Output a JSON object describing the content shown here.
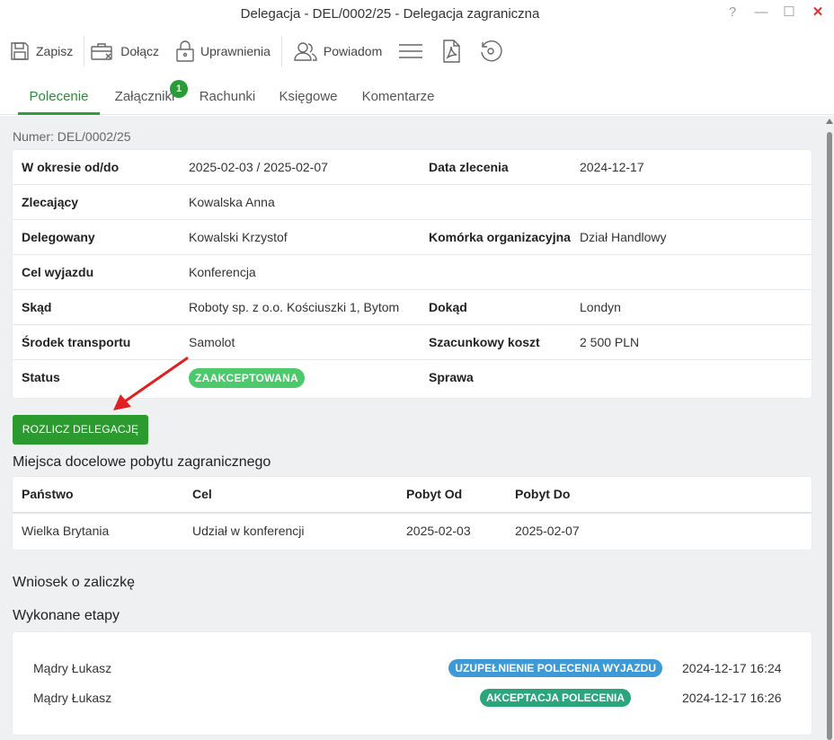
{
  "window": {
    "title": "Delegacja - DEL/0002/25 - Delegacja zagraniczna",
    "help_symbol": "?",
    "minimize_symbol": "—",
    "maximize_symbol": "☐",
    "close_symbol": "✕"
  },
  "toolbar": {
    "save_label": "Zapisz",
    "attach_label": "Dołącz",
    "permissions_label": "Uprawnienia",
    "notify_label": "Powiadom"
  },
  "tabs": [
    {
      "label": "Polecenie",
      "active": true
    },
    {
      "label": "Załączniki",
      "badge": "1"
    },
    {
      "label": "Rachunki"
    },
    {
      "label": "Księgowe"
    },
    {
      "label": "Komentarze"
    }
  ],
  "number_line": "Numer: DEL/0002/25",
  "details": {
    "period_label": "W okresie od/do",
    "period_value": "2025-02-03 / 2025-02-07",
    "order_date_label": "Data zlecenia",
    "order_date_value": "2024-12-17",
    "principal_label": "Zlecający",
    "principal_value": "Kowalska Anna",
    "delegate_label": "Delegowany",
    "delegate_value": "Kowalski Krzystof",
    "org_unit_label": "Komórka organizacyjna",
    "org_unit_value": "Dział Handlowy",
    "purpose_label": "Cel wyjazdu",
    "purpose_value": "Konferencja",
    "from_label": "Skąd",
    "from_value": "Roboty sp. z o.o. Kościuszki 1, Bytom",
    "to_label": "Dokąd",
    "to_value": "Londyn",
    "transport_label": "Środek transportu",
    "transport_value": "Samolot",
    "cost_label": "Szacunkowy koszt",
    "cost_value": "2 500 PLN",
    "status_label": "Status",
    "status_value": "ZAAKCEPTOWANA",
    "case_label": "Sprawa",
    "case_value": ""
  },
  "settle_button": "ROZLICZ DELEGACJĘ",
  "destinations": {
    "title": "Miejsca docelowe pobytu zagranicznego",
    "headers": [
      "Państwo",
      "Cel",
      "Pobyt Od",
      "Pobyt Do"
    ],
    "rows": [
      [
        "Wielka Brytania",
        "Udział w konferencji",
        "2025-02-03",
        "2025-02-07"
      ]
    ]
  },
  "advance_title": "Wniosek o zaliczkę",
  "stages": {
    "title": "Wykonane etapy",
    "items": [
      {
        "person": "Mądry Łukasz",
        "stage": "UZUPEŁNIENIE POLECENIA WYJAZDU",
        "datetime": "2024-12-17 16:24",
        "color": "#3d9ad6"
      },
      {
        "person": "Mądry Łukasz",
        "stage": "AKCEPTACJA POLECENIA",
        "datetime": "2024-12-17 16:26",
        "color": "#2aa57c"
      }
    ]
  },
  "colors": {
    "accent_green": "#2c9b2f",
    "status_green": "#4cc96a",
    "annotation_arrow": "#e02020"
  }
}
